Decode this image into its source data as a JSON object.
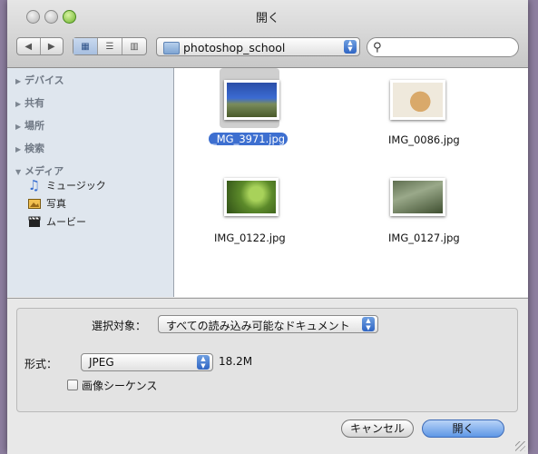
{
  "window": {
    "title": "開く"
  },
  "toolbar": {
    "nav_back": "◀",
    "nav_forward": "▶",
    "view_icon": "▦",
    "view_list": "☰",
    "view_columns": "▥",
    "location": "photoshop_school",
    "search_placeholder": ""
  },
  "sidebar": {
    "groups": [
      {
        "label": "デバイス",
        "expanded": false
      },
      {
        "label": "共有",
        "expanded": false
      },
      {
        "label": "場所",
        "expanded": false
      },
      {
        "label": "検索",
        "expanded": false
      },
      {
        "label": "メディア",
        "expanded": true
      }
    ],
    "media_items": [
      {
        "label": "ミュージック",
        "icon": "music-note-icon"
      },
      {
        "label": "写真",
        "icon": "photo-icon"
      },
      {
        "label": "ムービー",
        "icon": "clapperboard-icon"
      }
    ]
  },
  "files": [
    {
      "name": "_MG_3971.jpg",
      "selected": true
    },
    {
      "name": "IMG_0086.jpg",
      "selected": false
    },
    {
      "name": "IMG_0122.jpg",
      "selected": false
    },
    {
      "name": "IMG_0127.jpg",
      "selected": false
    }
  ],
  "options": {
    "enable_label": "選択対象：",
    "enable_value": "すべての読み込み可能なドキュメント",
    "format_label": "形式：",
    "format_value": "JPEG",
    "file_size": "18.2M",
    "image_sequence_label": "画像シーケンス",
    "image_sequence_checked": false
  },
  "buttons": {
    "cancel": "キャンセル",
    "open": "開く"
  },
  "colors": {
    "selection": "#3d6fd0",
    "sidebar_bg": "#dfe6ee",
    "default_button": "#5f97e6"
  }
}
